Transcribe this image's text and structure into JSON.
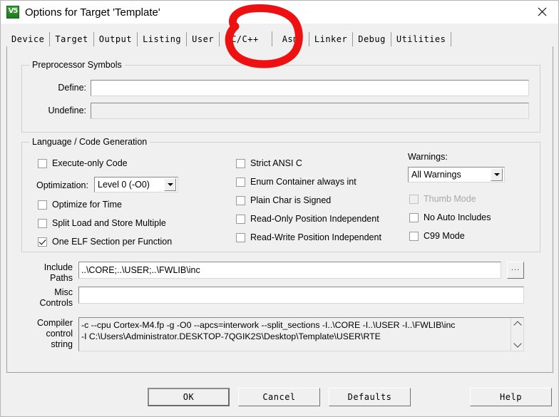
{
  "window": {
    "title": "Options for Target 'Template'",
    "app_icon": "keil-uvision-icon",
    "app_icon_text": "V5",
    "close_icon": "close-icon"
  },
  "tabs": [
    {
      "label": "Device",
      "active": false
    },
    {
      "label": "Target",
      "active": false
    },
    {
      "label": "Output",
      "active": false
    },
    {
      "label": "Listing",
      "active": false
    },
    {
      "label": "User",
      "active": false
    },
    {
      "label": "C/C++",
      "active": true
    },
    {
      "label": "Asm",
      "active": false
    },
    {
      "label": "Linker",
      "active": false
    },
    {
      "label": "Debug",
      "active": false
    },
    {
      "label": "Utilities",
      "active": false
    }
  ],
  "preprocessor": {
    "legend": "Preprocessor Symbols",
    "define_label": "Define:",
    "define_value": "",
    "define_placeholder": "",
    "undefine_label": "Undefine:",
    "undefine_value": "",
    "undefine_placeholder": ""
  },
  "language": {
    "legend": "Language / Code Generation",
    "left_column": [
      {
        "label": "Execute-only Code",
        "checked": false,
        "disabled": false
      },
      {
        "label": "Optimize for Time",
        "checked": false,
        "disabled": false
      },
      {
        "label": "Split Load and Store Multiple",
        "checked": false,
        "disabled": false
      },
      {
        "label": "One ELF Section per Function",
        "checked": true,
        "disabled": false
      }
    ],
    "optimization_label": "Optimization:",
    "optimization_value": "Level 0 (-O0)",
    "middle_column": [
      {
        "label": "Strict ANSI C",
        "checked": false,
        "disabled": false
      },
      {
        "label": "Enum Container always int",
        "checked": false,
        "disabled": false
      },
      {
        "label": "Plain Char is Signed",
        "checked": false,
        "disabled": false
      },
      {
        "label": "Read-Only Position Independent",
        "checked": false,
        "disabled": false
      },
      {
        "label": "Read-Write Position Independent",
        "checked": false,
        "disabled": false
      }
    ],
    "warnings_label": "Warnings:",
    "warnings_value": "All Warnings",
    "right_column": [
      {
        "label": "Thumb Mode",
        "checked": false,
        "disabled": true
      },
      {
        "label": "No Auto Includes",
        "checked": false,
        "disabled": false
      },
      {
        "label": "C99 Mode",
        "checked": false,
        "disabled": false
      }
    ]
  },
  "paths": {
    "include_label_line1": "Include",
    "include_label_line2": "Paths",
    "include_value": "..\\CORE;..\\USER;..\\FWLIB\\inc",
    "browse_label": "...",
    "misc_label_line1": "Misc",
    "misc_label_line2": "Controls",
    "misc_value": ""
  },
  "compiler": {
    "label_line1": "Compiler",
    "label_line2": "control",
    "label_line3": "string",
    "line1": "-c --cpu Cortex-M4.fp -g -O0 --apcs=interwork --split_sections -I..\\CORE -I..\\USER -I..\\FWLIB\\inc",
    "line2": "-I C:\\Users\\Administrator.DESKTOP-7QGIK2S\\Desktop\\Template\\USER\\RTE"
  },
  "buttons": {
    "ok": "OK",
    "cancel": "Cancel",
    "defaults": "Defaults",
    "help": "Help"
  },
  "annotation": {
    "type": "hand-drawn-circle",
    "color": "#ee1111",
    "target": "C/C++ tab"
  },
  "colors": {
    "dialog_background": "#f0f0f0",
    "titlebar_background": "#ffffff",
    "field_background": "#ffffff",
    "disabled_text": "#8a8a8a",
    "annotation_red": "#ee1111",
    "icon_green": "#1c7a1c"
  }
}
